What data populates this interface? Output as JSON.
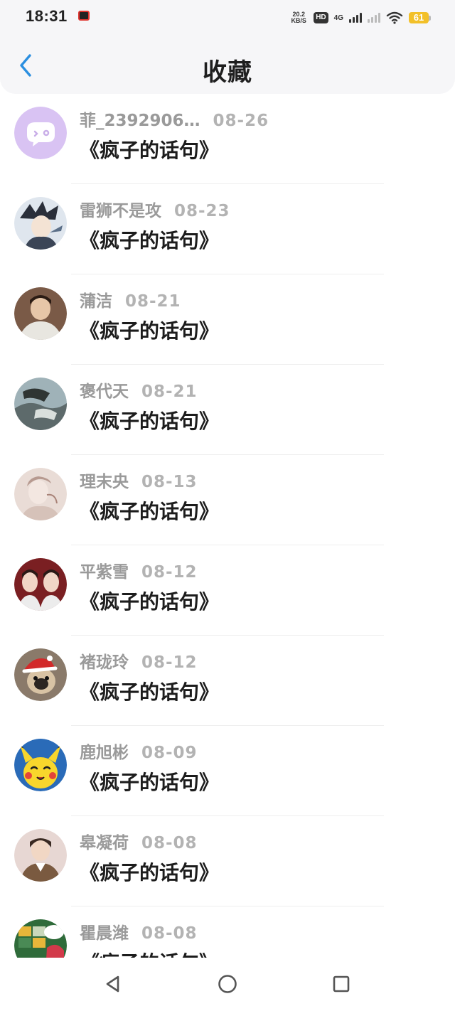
{
  "status_bar": {
    "time": "18:31",
    "net_speed_value": "20.2",
    "net_speed_unit": "KB/S",
    "hd_label": "HD",
    "hd_sub": "1",
    "network_type": "4G",
    "battery_level": "61",
    "battery_color": "#f2c029"
  },
  "header": {
    "back_icon": "chevron-left-icon",
    "title": "收藏",
    "accent_color": "#2b8fe0"
  },
  "items": [
    {
      "name": "菲_2392906…",
      "date": "08-26",
      "title": "《疯子的话句》",
      "avatar": "chat-bubble-placeholder"
    },
    {
      "name": "雷狮不是攻",
      "date": "08-23",
      "title": "《疯子的话句》",
      "avatar": "anime-character"
    },
    {
      "name": "蒲洁",
      "date": "08-21",
      "title": "《疯子的话句》",
      "avatar": "person-photo"
    },
    {
      "name": "褒代天",
      "date": "08-21",
      "title": "《疯子的话句》",
      "avatar": "landscape-photo"
    },
    {
      "name": "理末央",
      "date": "08-13",
      "title": "《疯子的话句》",
      "avatar": "sketch-portrait"
    },
    {
      "name": "平紫雪",
      "date": "08-12",
      "title": "《疯子的话句》",
      "avatar": "two-people-photo"
    },
    {
      "name": "褚珑玲",
      "date": "08-12",
      "title": "《疯子的话句》",
      "avatar": "pug-santa-hat"
    },
    {
      "name": "鹿旭彬",
      "date": "08-09",
      "title": "《疯子的话句》",
      "avatar": "pikachu"
    },
    {
      "name": "皋凝荷",
      "date": "08-08",
      "title": "《疯子的话句》",
      "avatar": "person-photo"
    },
    {
      "name": "瞿晨潍",
      "date": "08-08",
      "title": "《疯子的话句》",
      "avatar": "colorful-photo"
    }
  ],
  "nav_bar": {
    "back_icon": "triangle-back-icon",
    "home_icon": "circle-home-icon",
    "recents_icon": "square-recents-icon"
  }
}
